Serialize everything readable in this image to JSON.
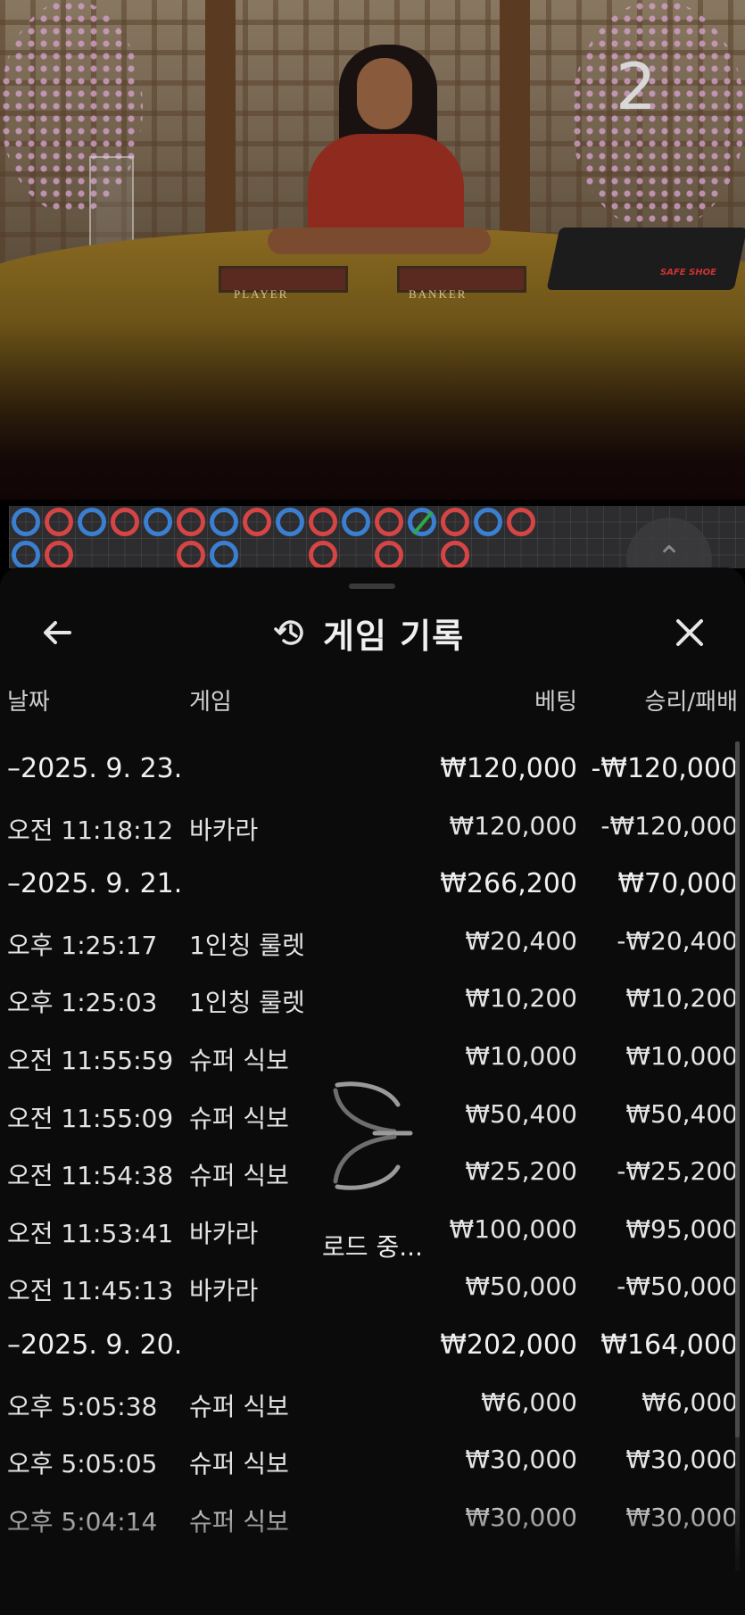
{
  "stream": {
    "round_number": "2",
    "player_label": "PLAYER",
    "banker_label": "BANKER",
    "shoe_label": "SAFE SHOE"
  },
  "colors": {
    "player_blue": "#3b7fd1",
    "banker_red": "#d64545",
    "tie_green": "#2ea84a",
    "sheet_bg": "#0b0b0b"
  },
  "bead_road": {
    "row1": [
      "P",
      "B",
      "P",
      "B",
      "P",
      "B",
      "P",
      "B",
      "P",
      "B",
      "P",
      "B",
      "T",
      "B",
      "P",
      "B"
    ],
    "row2": [
      "P",
      "B",
      "",
      "",
      "",
      "B",
      "P",
      "",
      "",
      "B",
      "",
      "B",
      "",
      "B",
      "",
      ""
    ]
  },
  "sheet": {
    "title": "게임 기록",
    "back_icon": "arrow-left-icon",
    "history_icon": "history-icon",
    "close_icon": "close-icon"
  },
  "table": {
    "headers": {
      "date": "날짜",
      "game": "게임",
      "bet": "베팅",
      "winloss": "승리/패배"
    },
    "rows": [
      {
        "type": "group",
        "date": "–2025. 9. 23.",
        "game": "",
        "bet": "₩120,000",
        "winloss": "-₩120,000"
      },
      {
        "type": "item",
        "date": "오전 11:18:12",
        "game": "바카라",
        "bet": "₩120,000",
        "winloss": "-₩120,000"
      },
      {
        "type": "group",
        "date": "–2025. 9. 21.",
        "game": "",
        "bet": "₩266,200",
        "winloss": "₩70,000"
      },
      {
        "type": "item",
        "date": "오후 1:25:17",
        "game": "1인칭 룰렛",
        "bet": "₩20,400",
        "winloss": "-₩20,400"
      },
      {
        "type": "item",
        "date": "오후 1:25:03",
        "game": "1인칭 룰렛",
        "bet": "₩10,200",
        "winloss": "₩10,200"
      },
      {
        "type": "item",
        "date": "오전 11:55:59",
        "game": "슈퍼 식보",
        "bet": "₩10,000",
        "winloss": "₩10,000"
      },
      {
        "type": "item",
        "date": "오전 11:55:09",
        "game": "슈퍼 식보",
        "bet": "₩50,400",
        "winloss": "₩50,400"
      },
      {
        "type": "item",
        "date": "오전 11:54:38",
        "game": "슈퍼 식보",
        "bet": "₩25,200",
        "winloss": "-₩25,200"
      },
      {
        "type": "item",
        "date": "오전 11:53:41",
        "game": "바카라",
        "bet": "₩100,000",
        "winloss": "₩95,000"
      },
      {
        "type": "item",
        "date": "오전 11:45:13",
        "game": "바카라",
        "bet": "₩50,000",
        "winloss": "-₩50,000"
      },
      {
        "type": "group",
        "date": "–2025. 9. 20.",
        "game": "",
        "bet": "₩202,000",
        "winloss": "₩164,000"
      },
      {
        "type": "item",
        "date": "오후 5:05:38",
        "game": "슈퍼 식보",
        "bet": "₩6,000",
        "winloss": "₩6,000"
      },
      {
        "type": "item",
        "date": "오후 5:05:05",
        "game": "슈퍼 식보",
        "bet": "₩30,000",
        "winloss": "₩30,000"
      },
      {
        "type": "item",
        "date": "오후 5:04:14",
        "game": "슈퍼 식보",
        "bet": "₩30,000",
        "winloss": "₩30,000"
      }
    ]
  },
  "loader": {
    "icon": "spinner-logo-icon",
    "text": "로드 중..."
  }
}
